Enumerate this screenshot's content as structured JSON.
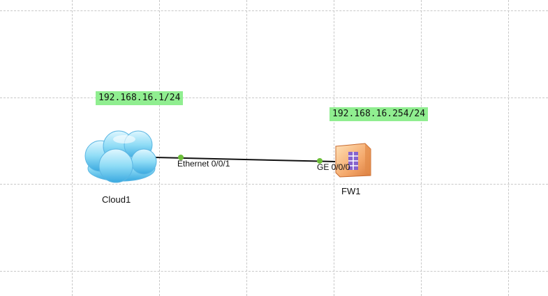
{
  "topology": {
    "cloud": {
      "name": "Cloud1",
      "ip": "192.168.16.1/24",
      "port": "Ethernet 0/0/1",
      "icon": "cloud-icon"
    },
    "firewall": {
      "name": "FW1",
      "ip": "192.168.16.254/24",
      "port": "GE 0/0/0",
      "icon": "firewall-icon"
    },
    "link_color": "#111111",
    "port_status_color": "#6dbf3a",
    "ip_label_color": "#90ee90"
  }
}
